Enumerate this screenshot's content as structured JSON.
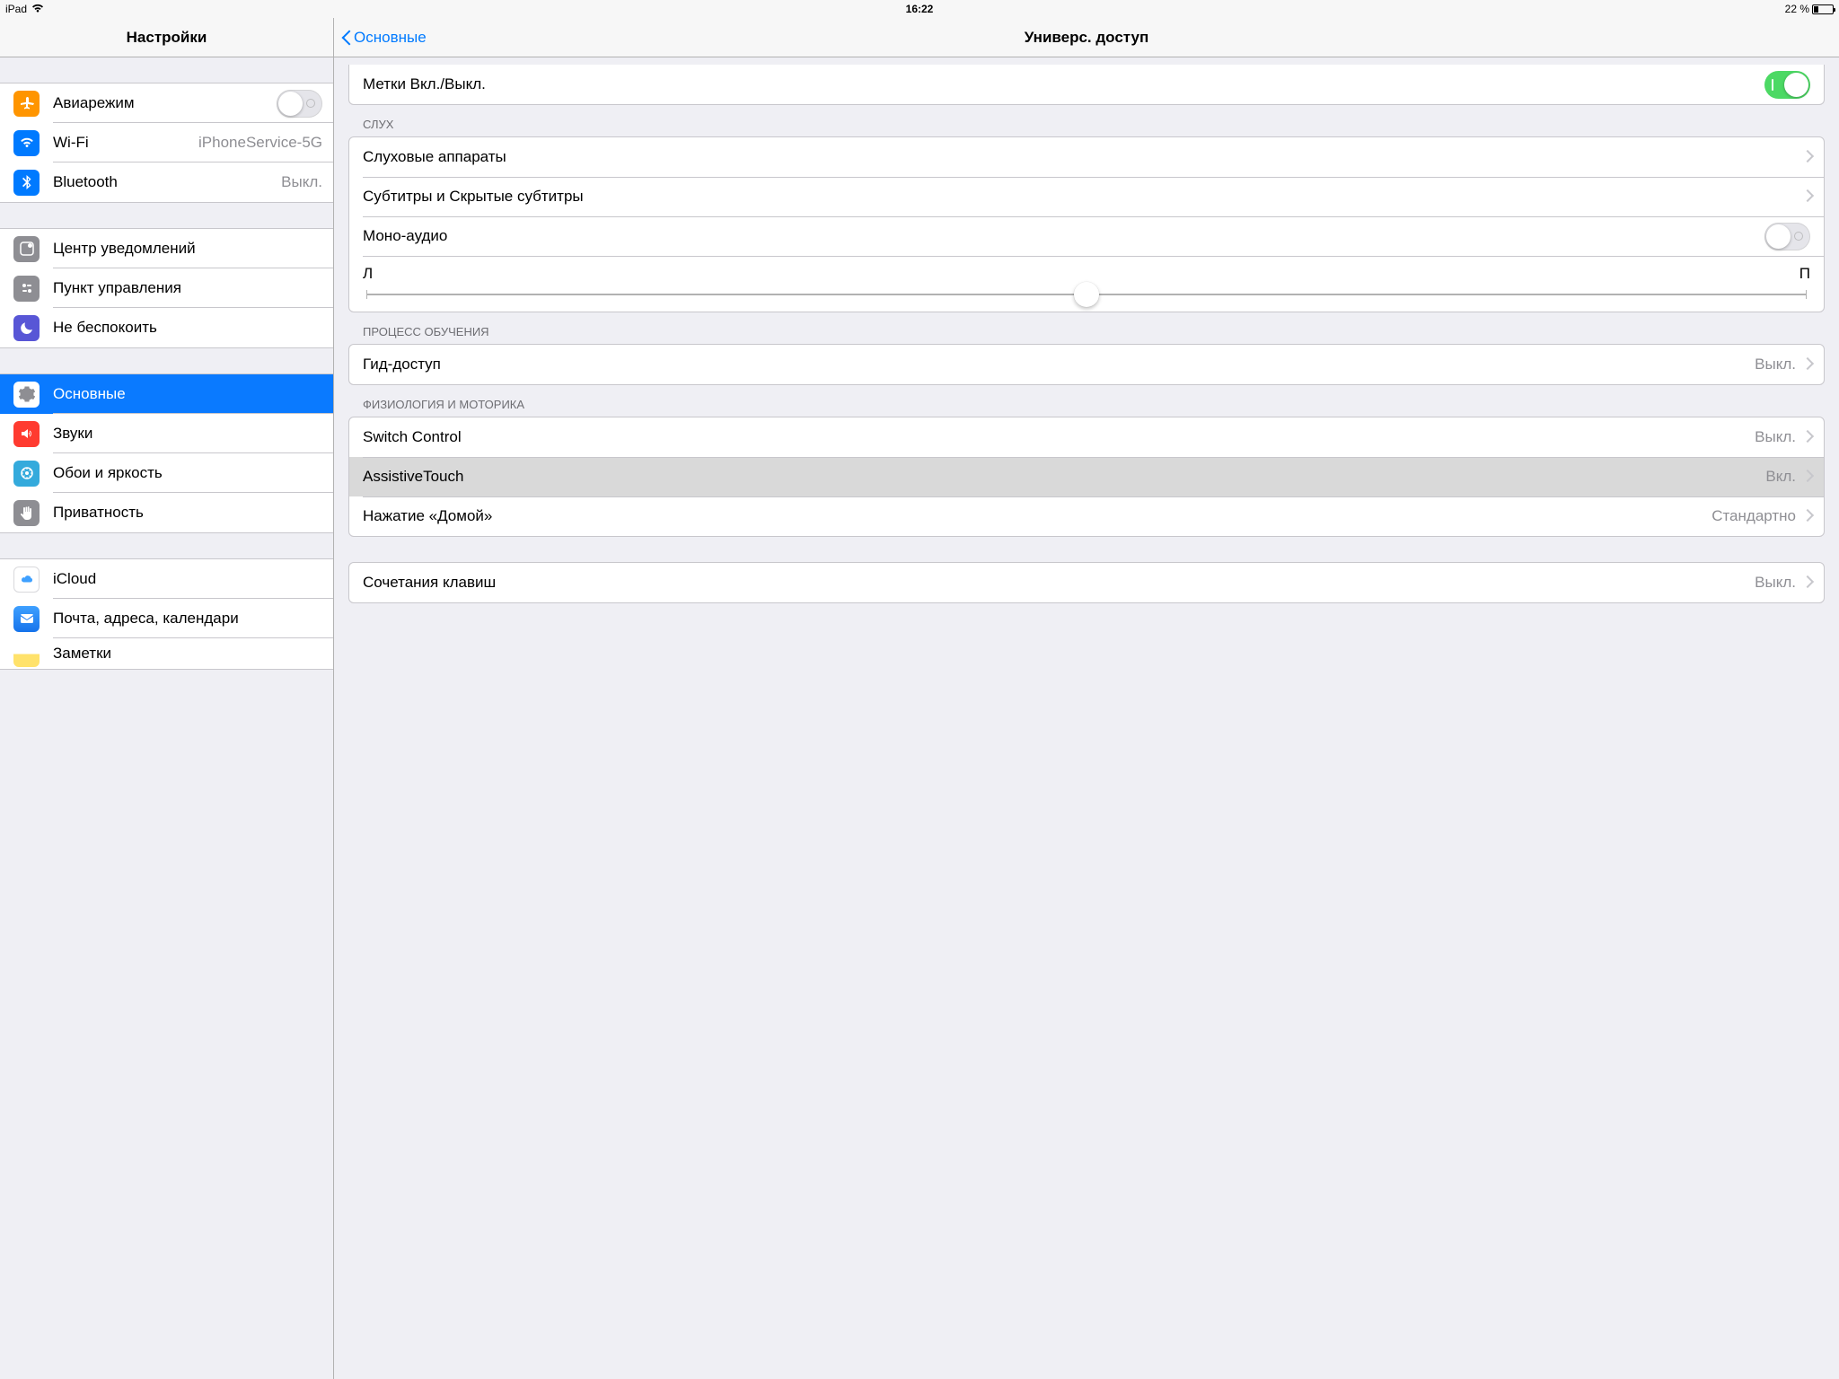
{
  "statusbar": {
    "device": "iPad",
    "time": "16:22",
    "battery_text": "22 %",
    "battery_pct": 22
  },
  "nav": {
    "sidebar_title": "Настройки",
    "back_label": "Основные",
    "detail_title": "Универс. доступ"
  },
  "sidebar": {
    "airplane": "Авиарежим",
    "wifi": "Wi-Fi",
    "wifi_value": "iPhoneService-5G",
    "bluetooth": "Bluetooth",
    "bluetooth_value": "Выкл.",
    "notif": "Центр уведомлений",
    "cc": "Пункт управления",
    "dnd": "Не беспокоить",
    "general": "Основные",
    "sounds": "Звуки",
    "wall": "Обои и яркость",
    "privacy": "Приватность",
    "icloud": "iCloud",
    "mail": "Почта, адреса, календари",
    "notes": "Заметки"
  },
  "detail": {
    "labels_toggle": "Метки Вкл./Выкл.",
    "sec_hearing": "СЛУХ",
    "hearing_aids": "Слуховые аппараты",
    "subtitles": "Субтитры и Скрытые субтитры",
    "mono_audio": "Моно-аудио",
    "balance_left": "Л",
    "balance_right": "П",
    "balance_pos": 0.5,
    "sec_learning": "ПРОЦЕСС ОБУЧЕНИЯ",
    "guided": "Гид-доступ",
    "guided_value": "Выкл.",
    "sec_phys": "ФИЗИОЛОГИЯ И МОТОРИКА",
    "switch_control": "Switch Control",
    "switch_value": "Выкл.",
    "assistive": "AssistiveTouch",
    "assistive_value": "Вкл.",
    "home": "Нажатие «Домой»",
    "home_value": "Стандартно",
    "shortcut": "Сочетания клавиш",
    "shortcut_value": "Выкл."
  }
}
